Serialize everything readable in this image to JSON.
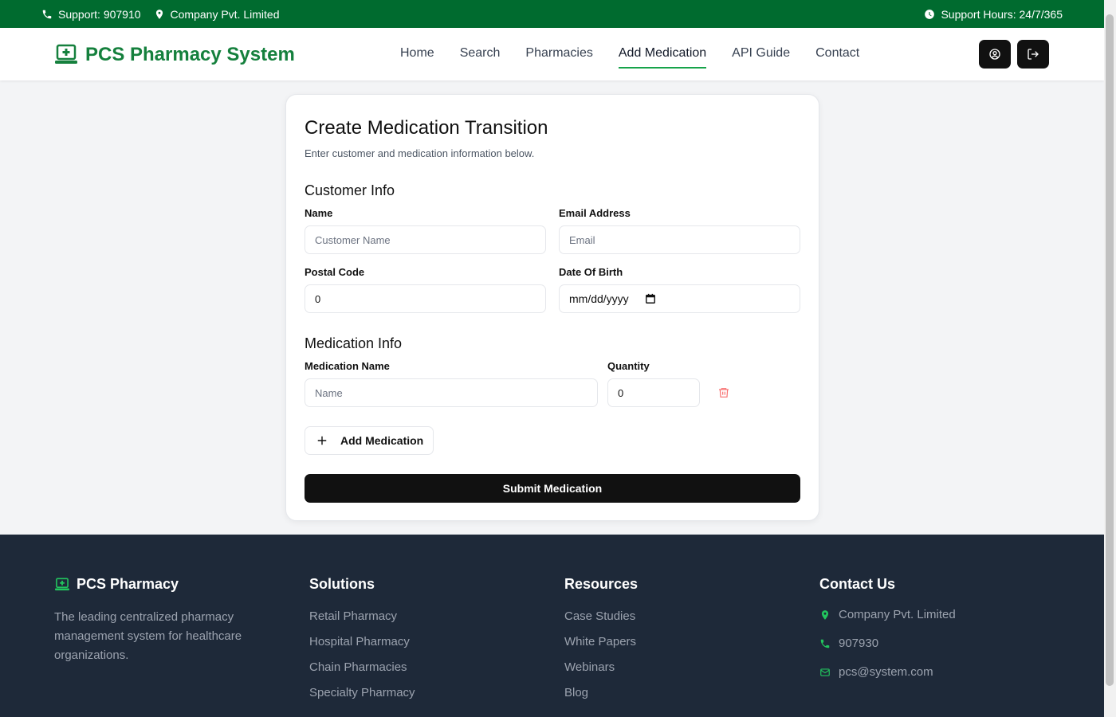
{
  "topbar": {
    "support": "Support: 907910",
    "company": "Company Pvt. Limited",
    "hours": "Support Hours: 24/7/365"
  },
  "nav": {
    "brand": "PCS Pharmacy System",
    "links": [
      "Home",
      "Search",
      "Pharmacies",
      "Add Medication",
      "API Guide",
      "Contact"
    ],
    "active": "Add Medication"
  },
  "form": {
    "title": "Create Medication Transition",
    "subtitle": "Enter customer and medication information below.",
    "customer_section": "Customer Info",
    "name_label": "Name",
    "name_placeholder": "Customer Name",
    "email_label": "Email Address",
    "email_placeholder": "Email",
    "postal_label": "Postal Code",
    "postal_value": "0",
    "dob_label": "Date Of Birth",
    "dob_placeholder": "mm/dd/yyyy",
    "medication_section": "Medication Info",
    "med_name_label": "Medication Name",
    "med_name_placeholder": "Name",
    "quantity_label": "Quantity",
    "quantity_value": "0",
    "add_button": "Add Medication",
    "submit_button": "Submit Medication"
  },
  "footer": {
    "brand": "PCS Pharmacy",
    "description": "The leading centralized pharmacy management system for healthcare organizations.",
    "solutions_title": "Solutions",
    "solutions": [
      "Retail Pharmacy",
      "Hospital Pharmacy",
      "Chain Pharmacies",
      "Specialty Pharmacy"
    ],
    "resources_title": "Resources",
    "resources": [
      "Case Studies",
      "White Papers",
      "Webinars",
      "Blog"
    ],
    "contact_title": "Contact Us",
    "contact_company": "Company Pvt. Limited",
    "contact_phone": "907930",
    "contact_email": "pcs@system.com"
  },
  "colors": {
    "topbar": "#006b2f",
    "brand": "#15803d",
    "footer": "#1e2939",
    "accent": "#22c55e"
  }
}
